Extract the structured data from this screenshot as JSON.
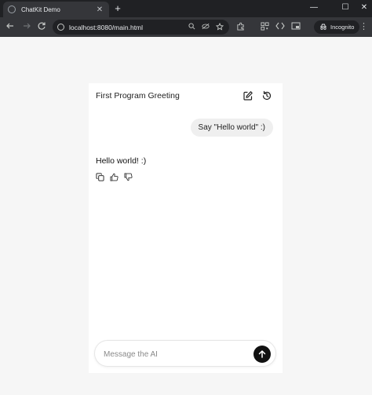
{
  "browser": {
    "tab_title": "ChatKit Demo",
    "tab_close": "✕",
    "new_tab": "+",
    "url": "localhost:8080/main.html",
    "incognito_label": "Incognito",
    "window_controls": {
      "minimize": "—",
      "maximize": "☐",
      "close": "✕"
    }
  },
  "chat": {
    "title": "First Program Greeting",
    "messages": [
      {
        "role": "user",
        "text": "Say \"Hello world\" :)"
      },
      {
        "role": "assistant",
        "text": "Hello world! :)"
      }
    ],
    "composer": {
      "placeholder": "Message the AI"
    }
  },
  "icons": [
    "compose-icon",
    "history-icon",
    "copy-icon",
    "thumbs-up-icon",
    "thumbs-down-icon",
    "arrow-up-icon"
  ]
}
